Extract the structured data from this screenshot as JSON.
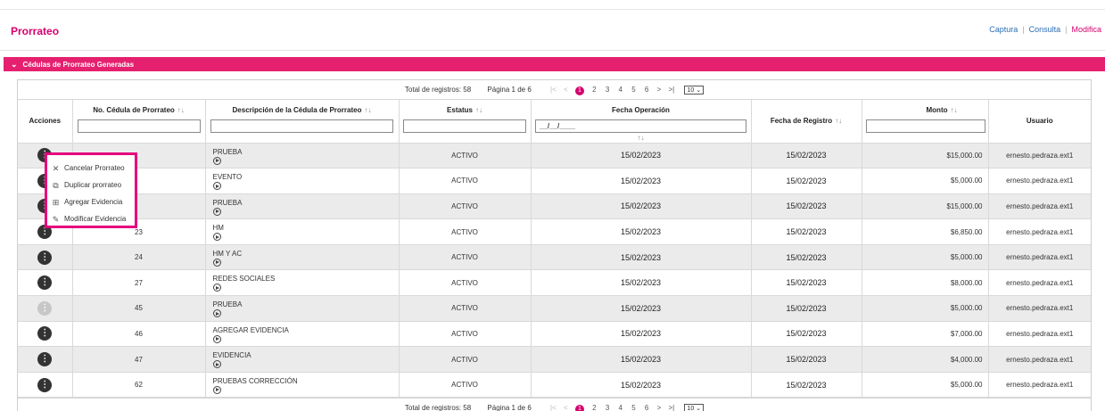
{
  "header": {
    "title": "Prorrateo",
    "nav": {
      "captura": "Captura",
      "consulta": "Consulta",
      "modifica": "Modifica",
      "sep": "|"
    }
  },
  "section": {
    "title": "Cédulas de Prorrateo Generadas",
    "chevron_icon": "chevron-down-icon"
  },
  "pager": {
    "total": "Total de registros: 58",
    "page_info": "Página 1 de 6",
    "first": "|<",
    "prev": "<",
    "pages": [
      "1",
      "2",
      "3",
      "4",
      "5",
      "6"
    ],
    "next": ">",
    "last": ">|",
    "page_size": "10"
  },
  "columns": {
    "acciones": "Acciones",
    "cedula": "No. Cédula de Prorrateo",
    "descripcion": "Descripción de la Cédula de Prorrateo",
    "estatus": "Estatus",
    "fecha_operacion": "Fecha Operación",
    "fecha_registro": "Fecha de Registro",
    "monto": "Monto",
    "usuario": "Usuario",
    "sort_glyph": "↑↓",
    "date_placeholder": "__/__/____"
  },
  "rows": [
    {
      "cedula": "",
      "descripcion": "PRUEBA",
      "estatus": "ACTIVO",
      "fecha_operacion": "15/02/2023",
      "fecha_registro": "15/02/2023",
      "monto": "$15,000.00",
      "usuario": "ernesto.pedraza.ext1"
    },
    {
      "cedula": "",
      "descripcion": "EVENTO",
      "estatus": "ACTIVO",
      "fecha_operacion": "15/02/2023",
      "fecha_registro": "15/02/2023",
      "monto": "$5,000.00",
      "usuario": "ernesto.pedraza.ext1"
    },
    {
      "cedula": "",
      "descripcion": "PRUEBA",
      "estatus": "ACTIVO",
      "fecha_operacion": "15/02/2023",
      "fecha_registro": "15/02/2023",
      "monto": "$15,000.00",
      "usuario": "ernesto.pedraza.ext1"
    },
    {
      "cedula": "23",
      "descripcion": "HM",
      "estatus": "ACTIVO",
      "fecha_operacion": "15/02/2023",
      "fecha_registro": "15/02/2023",
      "monto": "$6,850.00",
      "usuario": "ernesto.pedraza.ext1"
    },
    {
      "cedula": "24",
      "descripcion": "HM Y AC",
      "estatus": "ACTIVO",
      "fecha_operacion": "15/02/2023",
      "fecha_registro": "15/02/2023",
      "monto": "$5,000.00",
      "usuario": "ernesto.pedraza.ext1"
    },
    {
      "cedula": "27",
      "descripcion": "REDES SOCIALES",
      "estatus": "ACTIVO",
      "fecha_operacion": "15/02/2023",
      "fecha_registro": "15/02/2023",
      "monto": "$8,000.00",
      "usuario": "ernesto.pedraza.ext1"
    },
    {
      "cedula": "45",
      "descripcion": "PRUEBA",
      "estatus": "ACTIVO",
      "fecha_operacion": "15/02/2023",
      "fecha_registro": "15/02/2023",
      "monto": "$5,000.00",
      "usuario": "ernesto.pedraza.ext1",
      "disabled": true
    },
    {
      "cedula": "46",
      "descripcion": "AGREGAR EVIDENCIA",
      "estatus": "ACTIVO",
      "fecha_operacion": "15/02/2023",
      "fecha_registro": "15/02/2023",
      "monto": "$7,000.00",
      "usuario": "ernesto.pedraza.ext1"
    },
    {
      "cedula": "47",
      "descripcion": "EVIDENCIA",
      "estatus": "ACTIVO",
      "fecha_operacion": "15/02/2023",
      "fecha_registro": "15/02/2023",
      "monto": "$4,000.00",
      "usuario": "ernesto.pedraza.ext1"
    },
    {
      "cedula": "62",
      "descripcion": "PRUEBAS CORRECCIÓN",
      "estatus": "ACTIVO",
      "fecha_operacion": "15/02/2023",
      "fecha_registro": "15/02/2023",
      "monto": "$5,000.00",
      "usuario": "ernesto.pedraza.ext1"
    }
  ],
  "context_menu": [
    {
      "label": "Cancelar Prorrateo",
      "icon": "close-icon"
    },
    {
      "label": "Duplicar prorrateo",
      "icon": "copy-icon"
    },
    {
      "label": "Agregar Evidencia",
      "icon": "add-evidence-icon"
    },
    {
      "label": "Modificar Evidencia",
      "icon": "edit-icon"
    }
  ],
  "colors": {
    "accent": "#d5006d",
    "section_bar": "#e5206e",
    "link": "#2a6db5"
  }
}
